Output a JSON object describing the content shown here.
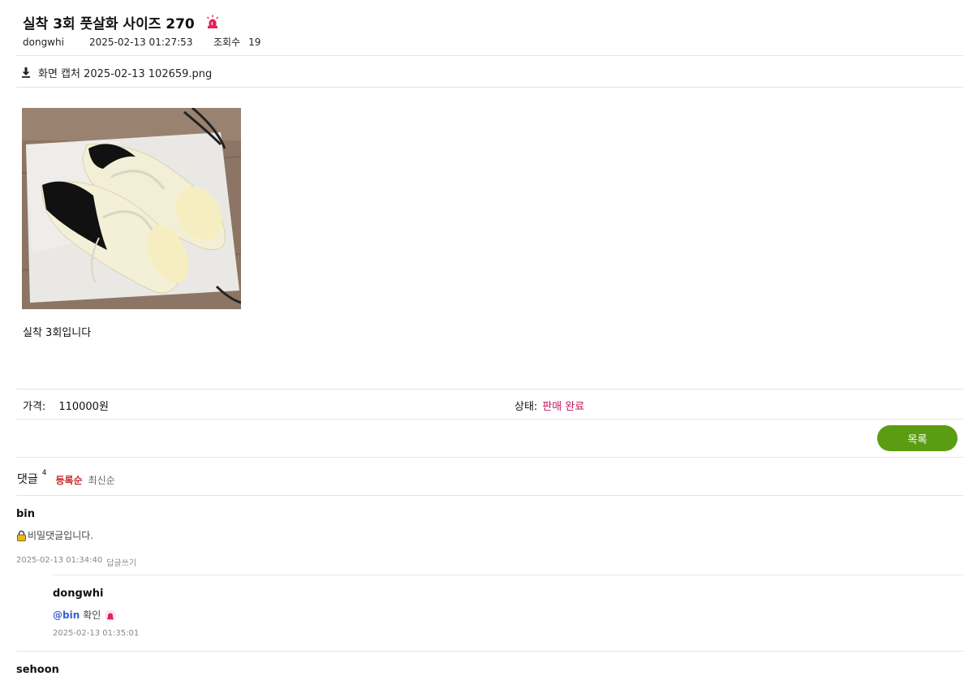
{
  "post": {
    "title": "실착 3회 풋살화 사이즈 270",
    "author": "dongwhi",
    "date": "2025-02-13 01:27:53",
    "views_label": "조회수",
    "views": "19",
    "attachment": "화면 캡처 2025-02-13 102659.png",
    "body": "실착 3회입니다",
    "price_label": "가격:",
    "price": "110000원",
    "status_label": "상태:",
    "status": "판매 완료",
    "status_color": "#c2185b"
  },
  "buttons": {
    "list": "목록"
  },
  "comments": {
    "title": "댓글",
    "count": "4",
    "sort_registered": "등록순",
    "sort_latest": "최신순",
    "items": [
      {
        "author": "bin",
        "text": "비밀댓글입니다.",
        "date": "2025-02-13 01:34:40",
        "reply": "답글쓰기"
      },
      {
        "author": "dongwhi",
        "mention": "@bin",
        "text": "확인",
        "date": "2025-02-13 01:35:01"
      },
      {
        "author": "sehoon"
      }
    ]
  },
  "colors": {
    "accent_green": "#5b9d12",
    "sort_active": "#c62828",
    "mention": "#3a5fcd"
  }
}
